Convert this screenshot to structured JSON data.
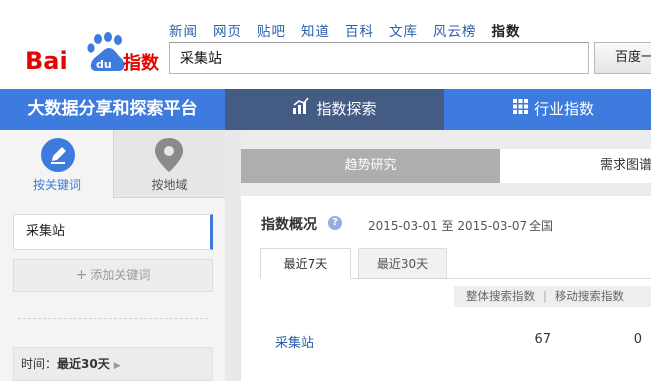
{
  "brand": {
    "logo_text": "Baidu指数",
    "blue": "#3d7cde",
    "red": "#e10602"
  },
  "top_nav": [
    {
      "label": "新闻",
      "active": false
    },
    {
      "label": "网页",
      "active": false
    },
    {
      "label": "贴吧",
      "active": false
    },
    {
      "label": "知道",
      "active": false
    },
    {
      "label": "百科",
      "active": false
    },
    {
      "label": "文库",
      "active": false
    },
    {
      "label": "风云榜",
      "active": false
    },
    {
      "label": "指数",
      "active": true
    }
  ],
  "search": {
    "value": "采集站",
    "button_label": "百度一下"
  },
  "main_bar": {
    "slogan": "大数据分享和探索平台",
    "tabs": [
      {
        "label": "指数探索",
        "icon": "bar-chart-icon",
        "active": true
      },
      {
        "label": "行业指数",
        "icon": "grid-icon",
        "active": false
      }
    ]
  },
  "sidebar": {
    "modes": [
      {
        "label": "按关键词",
        "icon": "edit-keyword-icon",
        "active": true
      },
      {
        "label": "按地域",
        "icon": "location-pin-icon",
        "active": false
      }
    ],
    "keyword": "采集站",
    "add_keyword_label": "添加关键词",
    "time_label": "时间：",
    "time_value": "最近30天"
  },
  "content": {
    "subtabs": [
      {
        "label": "趋势研究",
        "active": true
      },
      {
        "label": "需求图谱",
        "active": false
      }
    ],
    "overview": {
      "title": "指数概况",
      "date_range": "2015-03-01 至 2015-03-07",
      "region": "全国",
      "range_tabs": [
        {
          "label": "最近7天",
          "active": true
        },
        {
          "label": "最近30天",
          "active": false
        }
      ],
      "columns": [
        "整体搜索指数",
        "移动搜索指数"
      ],
      "rows": [
        {
          "keyword": "采集站",
          "overall": "67",
          "mobile": "0"
        }
      ]
    }
  }
}
